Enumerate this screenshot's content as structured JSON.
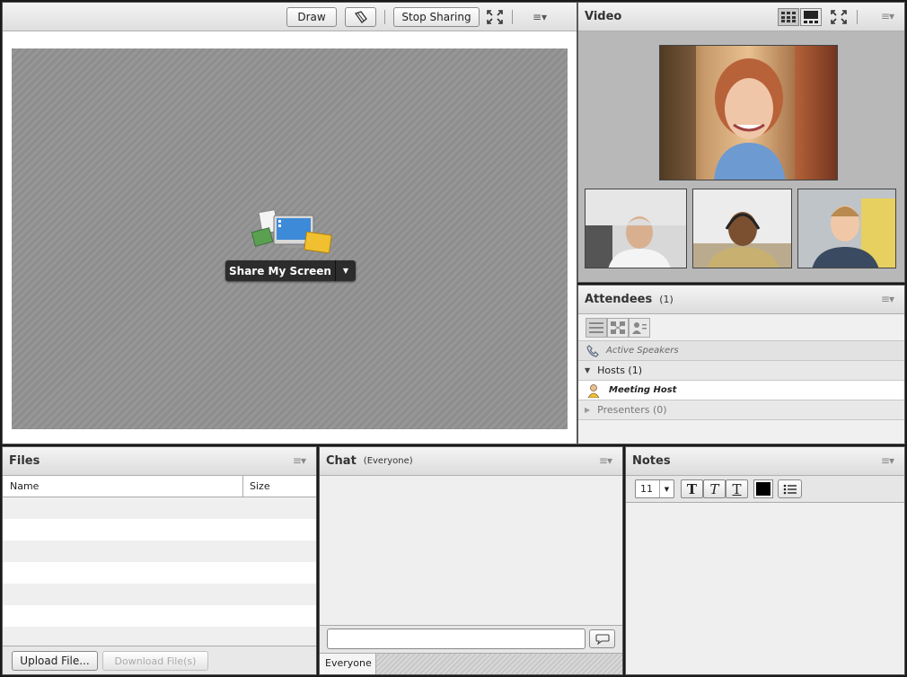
{
  "share": {
    "draw_label": "Draw",
    "stop_sharing_label": "Stop Sharing",
    "share_my_screen_label": "Share My Screen"
  },
  "video": {
    "title": "Video"
  },
  "attendees": {
    "title": "Attendees",
    "count": "(1)",
    "active_speakers": "Active Speakers",
    "hosts": "Hosts (1)",
    "host_name": "Meeting Host",
    "presenters": "Presenters (0)"
  },
  "files": {
    "title": "Files",
    "col_name": "Name",
    "col_size": "Size",
    "upload_label": "Upload File...",
    "download_label": "Download File(s)"
  },
  "chat": {
    "title": "Chat",
    "scope": "(Everyone)",
    "recipient_tab": "Everyone"
  },
  "notes": {
    "title": "Notes",
    "font_size": "11",
    "color": "#000000"
  }
}
